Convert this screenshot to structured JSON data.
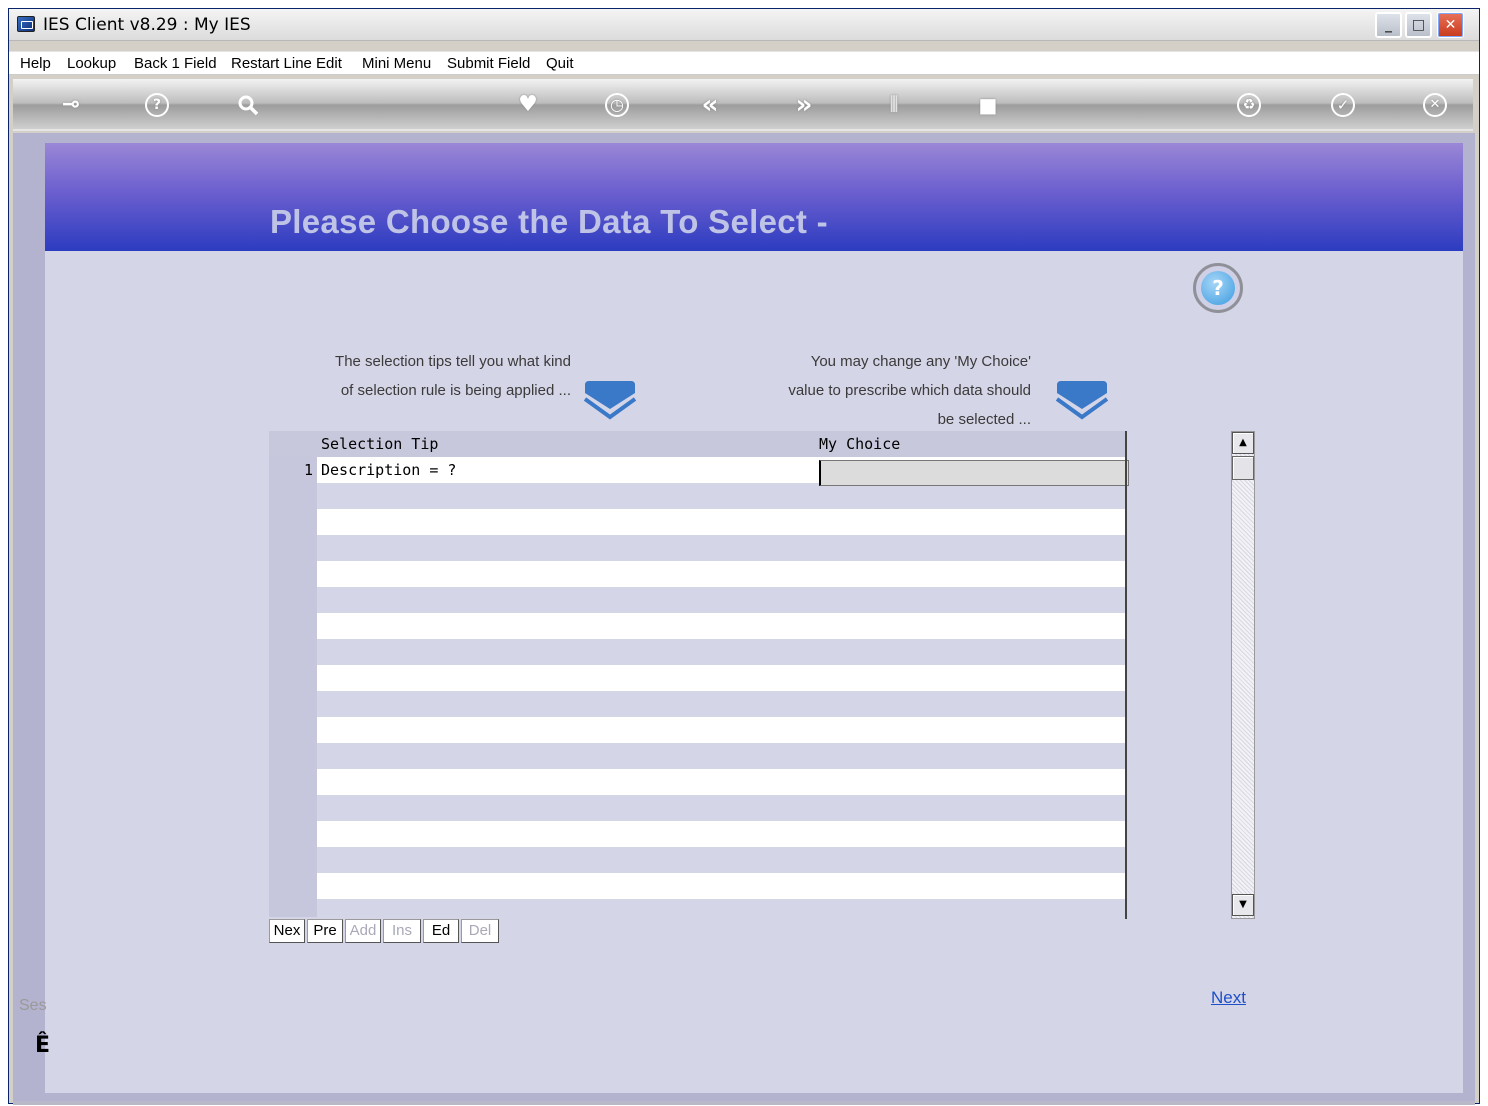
{
  "window": {
    "title": "IES Client v8.29 : My IES",
    "minimize_glyph": "_",
    "maximize_glyph": "□",
    "close_glyph": "✕"
  },
  "menu": {
    "items": [
      "Help",
      "Lookup",
      "Back 1 Field",
      "Restart Line Edit",
      "Mini Menu",
      "Submit Field",
      "Quit"
    ]
  },
  "toolbar": {
    "icons": [
      {
        "name": "key-icon",
        "glyph": "⊸"
      },
      {
        "name": "help-icon",
        "glyph": "?"
      },
      {
        "name": "search-icon",
        "glyph": "🔍"
      },
      {
        "name": "heart-icon",
        "glyph": "♥"
      },
      {
        "name": "clock-icon",
        "glyph": "◷"
      },
      {
        "name": "rewind-icon",
        "glyph": "«"
      },
      {
        "name": "forward-icon",
        "glyph": "»"
      },
      {
        "name": "columns-icon",
        "glyph": "⫼"
      },
      {
        "name": "chip-icon",
        "glyph": "■"
      },
      {
        "name": "recycle-icon",
        "glyph": "♻"
      },
      {
        "name": "check-icon",
        "glyph": "✓"
      },
      {
        "name": "close-icon",
        "glyph": "✕"
      }
    ]
  },
  "banner": {
    "title": "Please Choose the Data To Select -"
  },
  "help": {
    "glyph": "?"
  },
  "tips": {
    "left_line1": "The selection tips tell you what kind",
    "left_line2": "of selection rule is being applied ...",
    "right_line1": "You may change any 'My Choice'",
    "right_line2": "value to prescribe which data should",
    "right_line3": "be selected ..."
  },
  "grid": {
    "columns": [
      "Selection Tip",
      "My Choice"
    ],
    "rows": [
      {
        "num": "1",
        "tip": "Description = ?",
        "choice": ""
      }
    ]
  },
  "grid_buttons": [
    {
      "label": "Nex",
      "enabled": true
    },
    {
      "label": "Pre",
      "enabled": true
    },
    {
      "label": "Add",
      "enabled": false
    },
    {
      "label": "Ins",
      "enabled": false
    },
    {
      "label": "Ed",
      "enabled": true
    },
    {
      "label": "Del",
      "enabled": false
    }
  ],
  "scrollbar": {
    "up": "▲",
    "down": "▼"
  },
  "footer": {
    "next_link": "Next",
    "session_label": "Ses",
    "session_glyph": "Ê"
  },
  "colors": {
    "banner_top": "#9a87d6",
    "banner_bottom": "#2c3cc0",
    "content_bg": "#d5d5e8",
    "link": "#1f4fc8"
  }
}
